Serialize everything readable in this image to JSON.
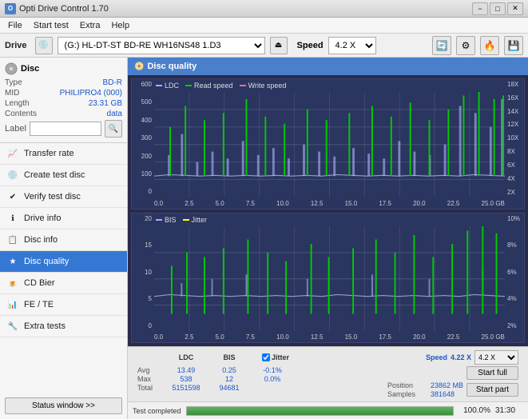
{
  "titleBar": {
    "title": "Opti Drive Control 1.70",
    "minBtn": "−",
    "maxBtn": "□",
    "closeBtn": "✕"
  },
  "menuBar": {
    "items": [
      "File",
      "Start test",
      "Extra",
      "Help"
    ]
  },
  "driveBar": {
    "label": "Drive",
    "driveValue": "(G:)  HL-DT-ST BD-RE  WH16NS48 1.D3",
    "speedLabel": "Speed",
    "speedValue": "4.2 X"
  },
  "disc": {
    "title": "Disc",
    "typeLabel": "Type",
    "typeValue": "BD-R",
    "midLabel": "MID",
    "midValue": "PHILIPRO4 (000)",
    "lengthLabel": "Length",
    "lengthValue": "23.31 GB",
    "contentsLabel": "Contents",
    "contentsValue": "data",
    "labelLabel": "Label"
  },
  "nav": {
    "items": [
      {
        "id": "transfer-rate",
        "label": "Transfer rate",
        "icon": "📈"
      },
      {
        "id": "create-test-disc",
        "label": "Create test disc",
        "icon": "💿"
      },
      {
        "id": "verify-test-disc",
        "label": "Verify test disc",
        "icon": "✔"
      },
      {
        "id": "drive-info",
        "label": "Drive info",
        "icon": "ℹ"
      },
      {
        "id": "disc-info",
        "label": "Disc info",
        "icon": "📋"
      },
      {
        "id": "disc-quality",
        "label": "Disc quality",
        "icon": "★",
        "active": true
      },
      {
        "id": "cd-bier",
        "label": "CD Bier",
        "icon": "🍺"
      },
      {
        "id": "fe-te",
        "label": "FE / TE",
        "icon": "📊"
      },
      {
        "id": "extra-tests",
        "label": "Extra tests",
        "icon": "🔧"
      }
    ],
    "statusBtn": "Status window >>"
  },
  "chartHeader": {
    "title": "Disc quality",
    "icon": "📀"
  },
  "chart1": {
    "legend": [
      {
        "label": "LDC",
        "color": "#ffffff"
      },
      {
        "label": "Read speed",
        "color": "#00cc00"
      },
      {
        "label": "Write speed",
        "color": "#ff69b4"
      }
    ],
    "yLabels": [
      "600",
      "500",
      "400",
      "300",
      "200",
      "100",
      "0"
    ],
    "yLabelsRight": [
      "18X",
      "16X",
      "14X",
      "12X",
      "10X",
      "8X",
      "6X",
      "4X",
      "2X"
    ],
    "xLabels": [
      "0.0",
      "2.5",
      "5.0",
      "7.5",
      "10.0",
      "12.5",
      "15.0",
      "17.5",
      "20.0",
      "22.5",
      "25.0 GB"
    ]
  },
  "chart2": {
    "legend": [
      {
        "label": "BIS",
        "color": "#ffffff"
      },
      {
        "label": "Jitter",
        "color": "#ffff00"
      }
    ],
    "yLabels": [
      "20",
      "15",
      "10",
      "5",
      "0"
    ],
    "yLabelsRight": [
      "10%",
      "8%",
      "6%",
      "4%",
      "2%"
    ],
    "xLabels": [
      "0.0",
      "2.5",
      "5.0",
      "7.5",
      "10.0",
      "12.5",
      "15.0",
      "17.5",
      "20.0",
      "22.5",
      "25.0 GB"
    ]
  },
  "stats": {
    "headers": [
      "LDC",
      "BIS",
      "",
      "Jitter",
      "Speed",
      ""
    ],
    "rows": [
      {
        "label": "Avg",
        "ldc": "13.49",
        "bis": "0.25",
        "jitter": "-0.1%",
        "speedLabel": "4.22 X"
      },
      {
        "label": "Max",
        "ldc": "538",
        "bis": "12",
        "jitter": "0.0%",
        "posLabel": "Position",
        "posVal": "23862 MB"
      },
      {
        "label": "Total",
        "ldc": "5151598",
        "bis": "94681",
        "jitter": "",
        "sampLabel": "Samples",
        "sampVal": "381648"
      }
    ],
    "jitterChecked": true,
    "speedDropdown": "4.2 X",
    "startFull": "Start full",
    "startPart": "Start part"
  },
  "progress": {
    "percent": "100.0%",
    "barWidth": 100,
    "time": "31:30",
    "statusText": "Test completed"
  }
}
